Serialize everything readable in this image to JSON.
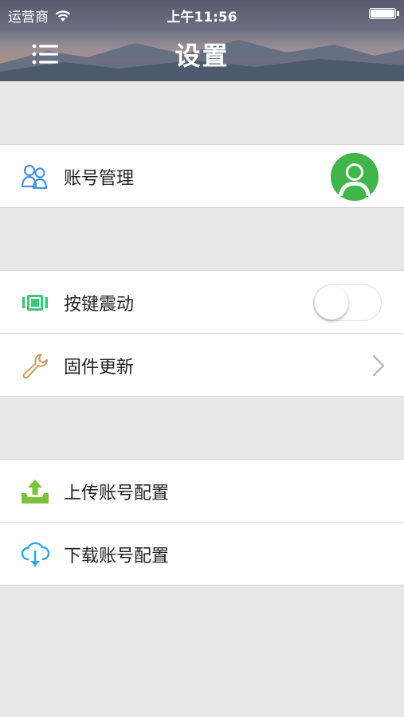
{
  "status_bar": {
    "carrier": "运营商",
    "time": "上午11:56"
  },
  "header": {
    "title": "设置",
    "menu_icon": "list-menu-icon"
  },
  "sections": {
    "account": {
      "label": "账号管理",
      "icon": "users-icon",
      "icon_color": "#4a90e2",
      "avatar_color": "#3fb54a"
    },
    "vibrate": {
      "label": "按键震动",
      "icon": "vibrate-icon",
      "icon_color": "#3cc77a",
      "toggle_on": false
    },
    "firmware": {
      "label": "固件更新",
      "icon": "wrench-icon",
      "icon_color": "#c9a06a"
    },
    "upload": {
      "label": "上传账号配置",
      "icon": "upload-icon",
      "icon_color": "#7cc13a"
    },
    "download": {
      "label": "下载账号配置",
      "icon": "cloud-download-icon",
      "icon_color": "#2ea8e5"
    }
  }
}
